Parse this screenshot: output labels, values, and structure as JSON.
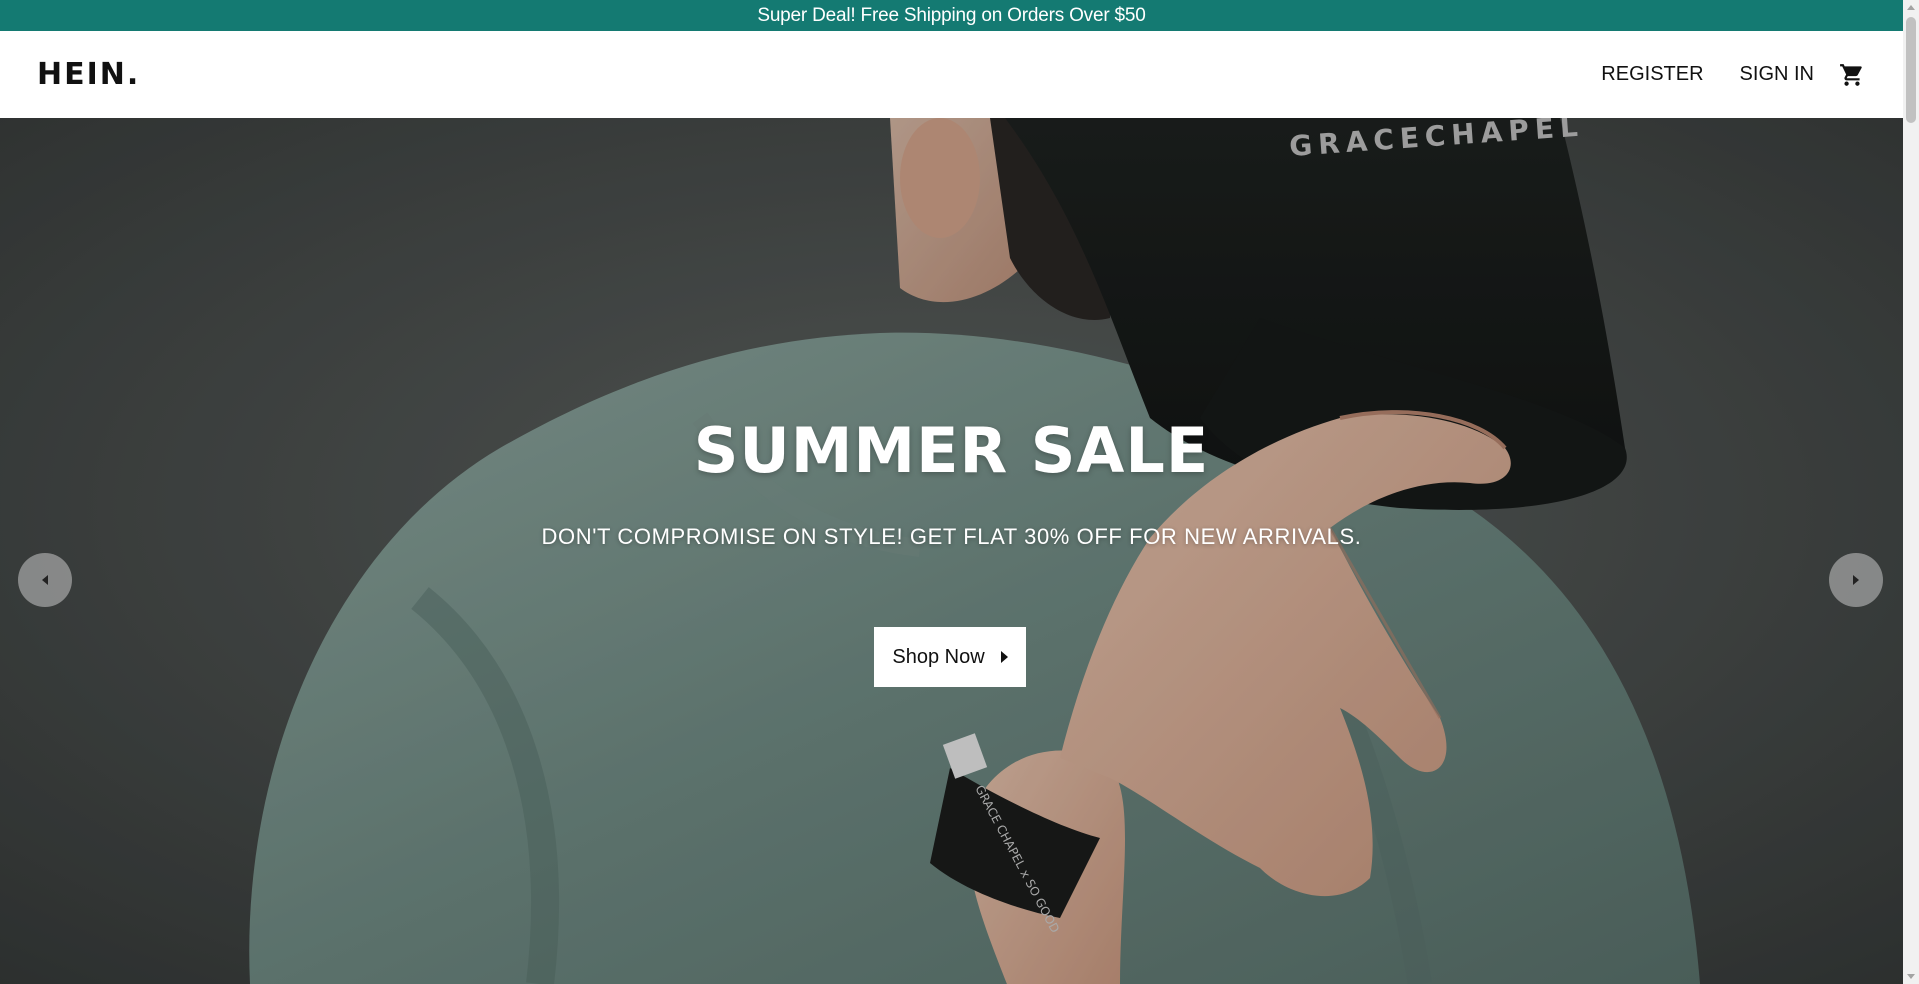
{
  "announcement": {
    "text": "Super Deal! Free Shipping on Orders Over $50",
    "background": "#147a72"
  },
  "header": {
    "logo": "HEIN.",
    "nav": {
      "register": "REGISTER",
      "sign_in": "SIGN IN",
      "cart_icon": "shopping-cart-icon"
    }
  },
  "hero": {
    "title": "SUMMER SALE",
    "subtitle": "DON'T COMPROMISE ON STYLE! GET FLAT 30% OFF FOR NEW ARRIVALS.",
    "cta_label": "Shop Now",
    "cta_icon": "caret-right-icon",
    "prev_icon": "caret-left-icon",
    "next_icon": "caret-right-icon",
    "cap_text": "GRACECHAPEL",
    "wristband_text": "GRACE CHAPEL x SO GOOD"
  }
}
